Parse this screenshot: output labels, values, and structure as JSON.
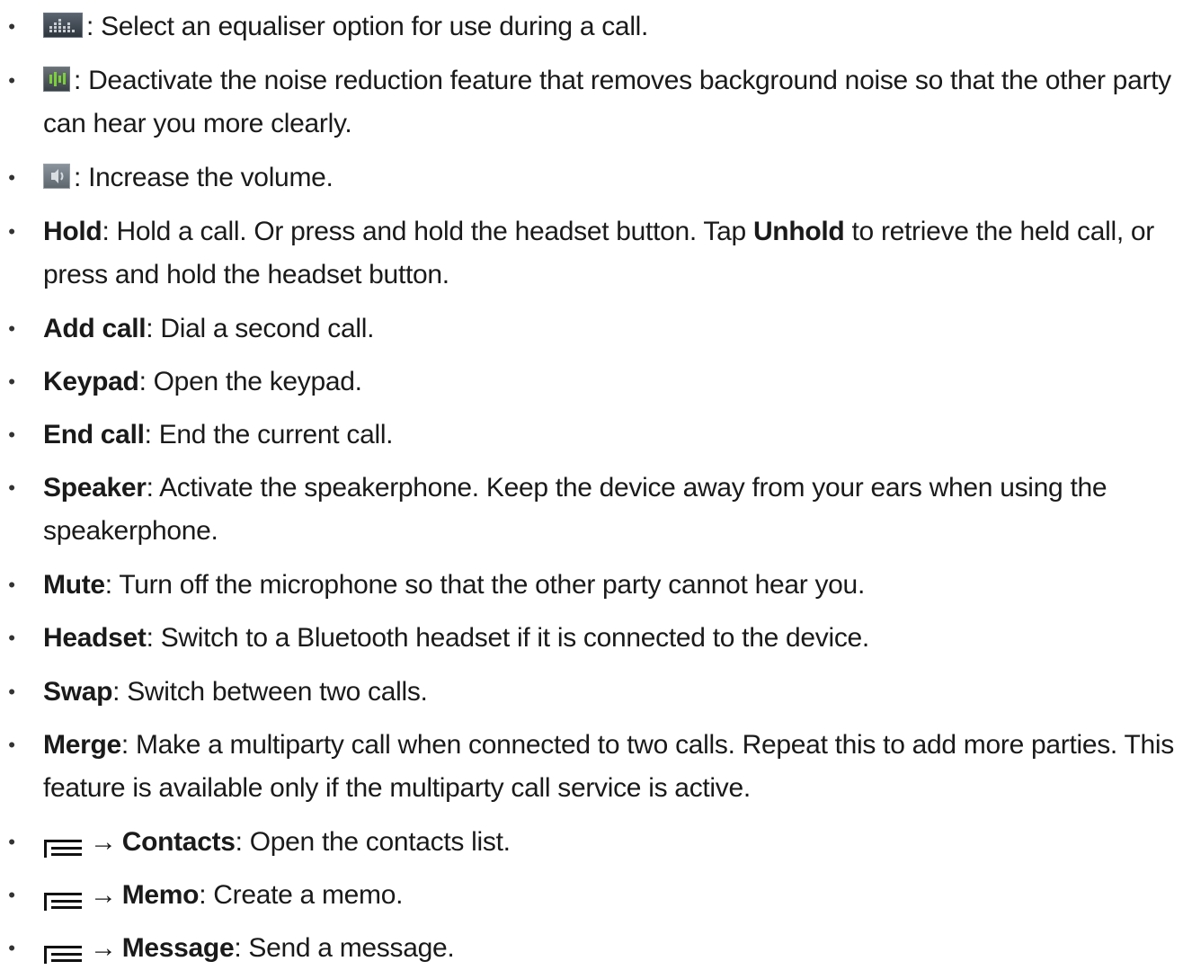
{
  "bullet_symbol": "•",
  "arrow_symbol": "→",
  "icons": {
    "equaliser": "equaliser-icon",
    "noise_reduction": "noise-reduction-icon",
    "volume": "volume-up-icon",
    "menu": "menu-icon"
  },
  "items": [
    {
      "text": ": Select an equaliser option for use during a call."
    },
    {
      "text": ": Deactivate the noise reduction feature that removes background noise so that the other party can hear you more clearly."
    },
    {
      "text": ": Increase the volume."
    },
    {
      "term": "Hold",
      "text_a": ": Hold a call. Or press and hold the headset button. Tap ",
      "term2": "Unhold",
      "text_b": " to retrieve the held call, or press and hold the headset button."
    },
    {
      "term": "Add call",
      "text": ": Dial a second call."
    },
    {
      "term": "Keypad",
      "text": ": Open the keypad."
    },
    {
      "term": "End call",
      "text": ": End the current call."
    },
    {
      "term": "Speaker",
      "text": ": Activate the speakerphone. Keep the device away from your ears when using the speakerphone."
    },
    {
      "term": "Mute",
      "text": ": Turn off the microphone so that the other party cannot hear you."
    },
    {
      "term": "Headset",
      "text": ": Switch to a Bluetooth headset if it is connected to the device."
    },
    {
      "term": "Swap",
      "text": ": Switch between two calls."
    },
    {
      "term": "Merge",
      "text": ": Make a multiparty call when connected to two calls. Repeat this to add more parties. This feature is available only if the multiparty call service is active."
    },
    {
      "term": "Contacts",
      "text": ": Open the contacts list."
    },
    {
      "term": "Memo",
      "text": ": Create a memo."
    },
    {
      "term": "Message",
      "text": ": Send a message."
    }
  ]
}
